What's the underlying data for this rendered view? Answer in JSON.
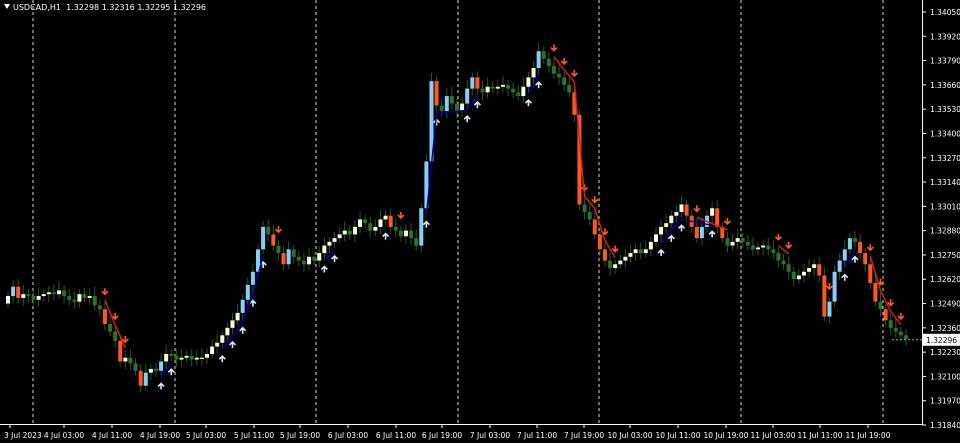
{
  "header": {
    "symbol_tf": "USDCAD,H1",
    "ohlc": "1.32298 1.32316 1.32295 1.32296"
  },
  "colors": {
    "background": "#000000",
    "axis": "#ffffff",
    "grid": "#ffffff",
    "bull_body_strong": "#87cefa",
    "bull_body_weak": "#ffffe0",
    "bear_body_strong": "#ff5722",
    "wick_trend": "#1f5f1f",
    "up_arrow": "#d6ecff",
    "down_arrow": "#ff5a1f",
    "support_line": "#0000a8",
    "resistance_line": "#e02020",
    "current_price_box": "#ffffff"
  },
  "chart_data": {
    "type": "candlestick",
    "symbol": "USDCAD",
    "timeframe": "H1",
    "y_ticks": [
      "1.34050",
      "1.33920",
      "1.33790",
      "1.33660",
      "1.33530",
      "1.33400",
      "1.33270",
      "1.33140",
      "1.33010",
      "1.32880",
      "1.32750",
      "1.32620",
      "1.32490",
      "1.32360",
      "1.32230",
      "1.32100",
      "1.31970",
      "1.31840"
    ],
    "ylim": [
      1.3178,
      1.3408
    ],
    "current_price": "1.32296",
    "x_ticks": [
      "3 Jul 2023",
      "4 Jul 03:00",
      "4 Jul 11:00",
      "4 Jul 19:00",
      "5 Jul 03:00",
      "5 Jul 11:00",
      "5 Jul 19:00",
      "6 Jul 03:00",
      "6 Jul 11:00",
      "6 Jul 19:00",
      "7 Jul 03:00",
      "7 Jul 11:00",
      "7 Jul 19:00",
      "10 Jul 03:00",
      "10 Jul 11:00",
      "10 Jul 19:00",
      "11 Jul 03:00",
      "11 Jul 11:00",
      "11 Jul 19:00"
    ],
    "grid": "vertical dashed separators",
    "closes": [
      1.3253,
      1.3258,
      1.3252,
      1.3254,
      1.3253,
      1.3251,
      1.3253,
      1.3254,
      1.3255,
      1.3254,
      1.3256,
      1.3253,
      1.3251,
      1.325,
      1.3254,
      1.3252,
      1.3253,
      1.3248,
      1.3246,
      1.3238,
      1.3234,
      1.3229,
      1.3218,
      1.322,
      1.3217,
      1.3213,
      1.3205,
      1.3212,
      1.3214,
      1.3213,
      1.3218,
      1.3222,
      1.3221,
      1.3219,
      1.322,
      1.3221,
      1.3219,
      1.322,
      1.322,
      1.3222,
      1.3226,
      1.3228,
      1.3232,
      1.3236,
      1.324,
      1.3244,
      1.3251,
      1.3259,
      1.3266,
      1.3278,
      1.329,
      1.3286,
      1.328,
      1.3276,
      1.327,
      1.3278,
      1.3274,
      1.3272,
      1.327,
      1.3274,
      1.3272,
      1.3276,
      1.328,
      1.3282,
      1.3284,
      1.3286,
      1.3288,
      1.3286,
      1.329,
      1.3294,
      1.3292,
      1.3288,
      1.329,
      1.3294,
      1.3296,
      1.329,
      1.3288,
      1.3285,
      1.3288,
      1.3284,
      1.328,
      1.33,
      1.3325,
      1.3368,
      1.3355,
      1.3352,
      1.336,
      1.3356,
      1.3352,
      1.3356,
      1.3364,
      1.337,
      1.3364,
      1.3362,
      1.3365,
      1.3364,
      1.3365,
      1.3366,
      1.3364,
      1.3362,
      1.336,
      1.3365,
      1.337,
      1.3375,
      1.3384,
      1.338,
      1.3376,
      1.3372,
      1.337,
      1.3366,
      1.3362,
      1.335,
      1.3302,
      1.3298,
      1.3294,
      1.3286,
      1.3278,
      1.3272,
      1.3268,
      1.327,
      1.3272,
      1.3274,
      1.3276,
      1.3278,
      1.3276,
      1.3278,
      1.3282,
      1.3286,
      1.329,
      1.3292,
      1.3296,
      1.3298,
      1.3302,
      1.3296,
      1.329,
      1.3284,
      1.329,
      1.3296,
      1.33,
      1.329,
      1.3284,
      1.328,
      1.3282,
      1.3284,
      1.3282,
      1.328,
      1.3278,
      1.3279,
      1.328,
      1.3278,
      1.3276,
      1.3272,
      1.327,
      1.3266,
      1.3262,
      1.3264,
      1.3266,
      1.3268,
      1.327,
      1.3264,
      1.3242,
      1.325,
      1.3266,
      1.3272,
      1.3278,
      1.3284,
      1.3282,
      1.3276,
      1.327,
      1.326,
      1.325,
      1.3246,
      1.324,
      1.3236,
      1.3234,
      1.3232,
      1.323
    ],
    "buy_signals": 38,
    "sell_signals": 34
  }
}
